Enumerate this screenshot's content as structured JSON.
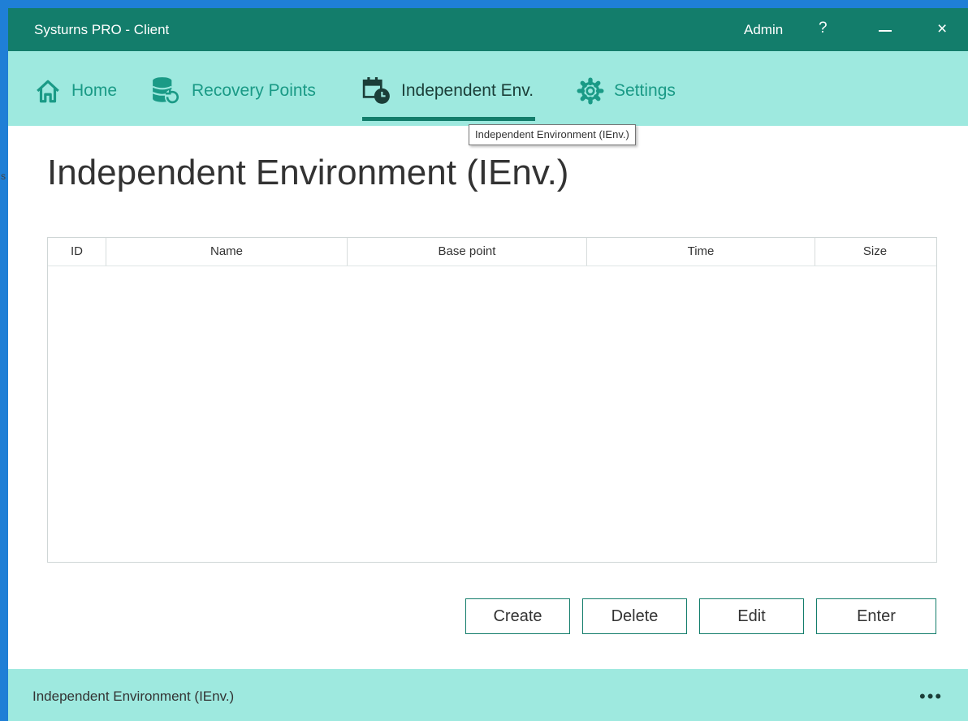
{
  "window": {
    "title": "Systurns PRO - Client",
    "user": "Admin",
    "help": "?",
    "close": "×"
  },
  "nav": {
    "home": "Home",
    "recovery_points": "Recovery Points",
    "independent_env": "Independent Env.",
    "settings": "Settings",
    "active": "independent_env"
  },
  "tooltip": "Independent Environment (IEnv.)",
  "page": {
    "title": "Independent Environment (IEnv.)"
  },
  "table": {
    "columns": [
      "ID",
      "Name",
      "Base point",
      "Time",
      "Size"
    ],
    "rows": []
  },
  "actions": {
    "create": "Create",
    "delete": "Delete",
    "edit": "Edit",
    "enter": "Enter"
  },
  "status": {
    "text": "Independent Environment (IEnv.)",
    "more": "•••"
  },
  "desktop": {
    "sliver_text": "s"
  },
  "colors": {
    "titlebar": "#137d6b",
    "accent_bar": "#9ee9df",
    "nav_text": "#1a9a86",
    "active_text": "#1b3e38",
    "desktop": "#1f7fd6"
  },
  "icons": {
    "home": "home-icon",
    "recovery_points": "database-restore-icon",
    "independent_env": "calendar-clock-icon",
    "settings": "gear-icon"
  }
}
